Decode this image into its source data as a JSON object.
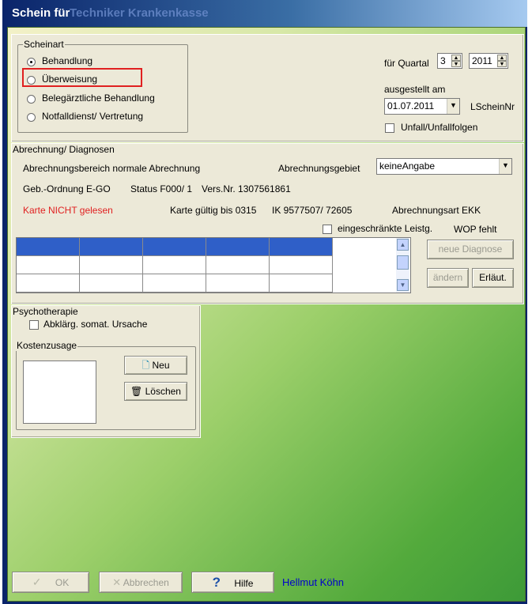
{
  "window": {
    "title": "Schein für",
    "title_greyed": "Techniker Krankenkasse"
  },
  "scheinart": {
    "legend": "Scheinart",
    "options": [
      {
        "label": "Behandlung",
        "checked": true
      },
      {
        "label": "Überweisung",
        "checked": false
      },
      {
        "label": "Belegärztliche Behandlung",
        "checked": false
      },
      {
        "label": "Notfalldienst/ Vertretung",
        "checked": false
      }
    ]
  },
  "quartal": {
    "label": "für Quartal",
    "value": "3",
    "year": "2011"
  },
  "ausgestellt": {
    "label": "ausgestellt am",
    "date": "01.07.2011",
    "lscheinnr_label": "LScheinNr"
  },
  "unfall": {
    "label": "Unfall/Unfallfolgen",
    "checked": false
  },
  "abrechnung": {
    "legend": "Abrechnung/ Diagnosen",
    "bereich": "Abrechnungsbereich normale Abrechnung",
    "gebiet_label": "Abrechnungsgebiet",
    "gebiet_value": "keineAngabe",
    "gebo": "Geb.-Ordnung E-GO",
    "status": "Status F000/ 1",
    "versnr": "Vers.Nr. 1307561861",
    "karte_status": "Karte NICHT gelesen",
    "karte_gueltig": "Karte gültig bis 0315",
    "ik": "IK 9577507/ 72605",
    "abrechnungsart": "Abrechnungsart  EKK",
    "eingeschraenkt": "eingeschränkte Leistg.",
    "wop": "WOP fehlt",
    "neue_diagnose": "neue Diagnose",
    "aendern": "ändern",
    "erlaeut": "Erläut."
  },
  "psychotherapie": {
    "legend": "Psychotherapie",
    "abklaerung": "Abklärg. somat. Ursache",
    "kostenzusage": "Kostenzusage",
    "neu": "Neu",
    "loeschen": "Löschen"
  },
  "footer": {
    "ok": "OK",
    "abbrechen": "Abbrechen",
    "hilfe": "Hilfe",
    "user": "Hellmut Köhn"
  },
  "colors": {
    "highlight": "#e02020",
    "warning_text": "#e02020",
    "user_text": "#0000cc"
  }
}
